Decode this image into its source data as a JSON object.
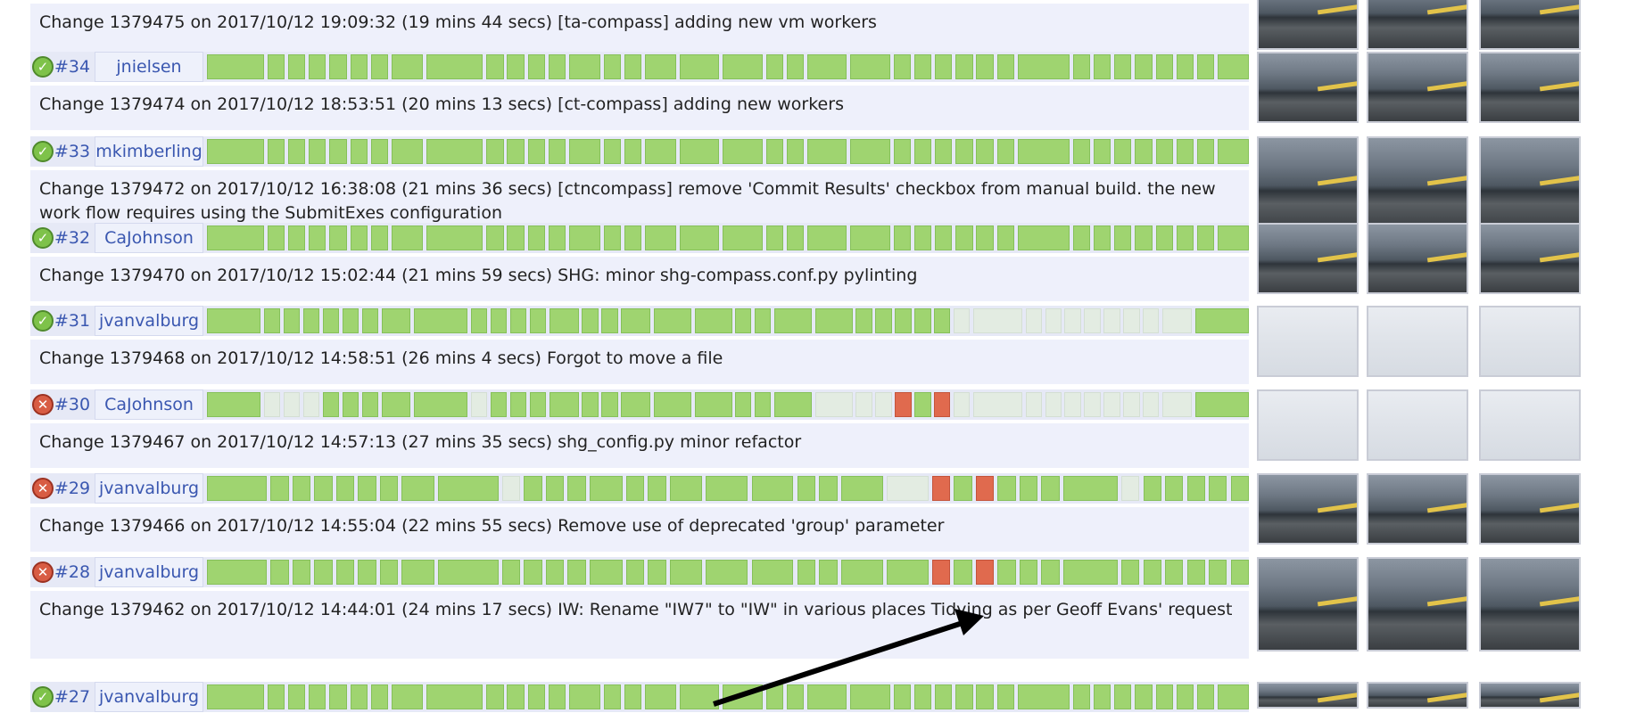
{
  "builds": [
    {
      "num": "",
      "user": "",
      "status": "ok",
      "message": "Change 1379475 on 2017/10/12 19:09:32 (19 mins 44 secs) [ta-compass] adding new vm workers",
      "segments": "gggggggggggggggggggggggggggggggggggggg",
      "thumbs": "dark"
    },
    {
      "num": "#34",
      "user": "jnielsen",
      "status": "ok",
      "message": "Change 1379474 on 2017/10/12 18:53:51 (20 mins 13 secs) [ct-compass] adding new workers",
      "segments": "gggggggggggggggggggggggggggggggggggggg",
      "thumbs": "dark"
    },
    {
      "num": "#33",
      "user": "mkimberling",
      "status": "ok",
      "message": "Change 1379472 on 2017/10/12 16:38:08 (21 mins 36 secs) [ctncompass] remove 'Commit Results' checkbox from manual build. the new work flow requires using the SubmitExes configuration",
      "segments": "gggggggggggggggggggggggggggggggggggggg",
      "thumbs": "dark"
    },
    {
      "num": "#32",
      "user": "CaJohnson",
      "status": "ok",
      "message": "Change 1379470 on 2017/10/12 15:02:44 (21 mins 59 secs) SHG: minor shg-compass.conf.py pylinting",
      "segments": "gggggggggggggggggggggggggggggggggggggg",
      "thumbs": "dark"
    },
    {
      "num": "#31",
      "user": "jvanvalburg",
      "status": "ok",
      "message": "Change 1379468 on 2017/10/12 14:58:51 (26 mins 4 secs) Forgot to move a file",
      "segments": "ggggggggggggggggggggggggggggllllllllllg",
      "thumbs": "pale"
    },
    {
      "num": "#30",
      "user": "CaJohnson",
      "status": "fail",
      "message": "Change 1379467 on 2017/10/12 14:57:13 (27 mins 35 secs) shg_config.py minor refactor",
      "segments": "glllggggglgggggggggggglllrgrllllllllllg",
      "thumbs": "pale"
    },
    {
      "num": "#29",
      "user": "jvanvalburg",
      "status": "fail",
      "message": "Change 1379466 on 2017/10/12 14:55:04 (22 mins 55 secs) Remove use of deprecated 'group' parameter",
      "segments": "ggggggggglgggggggggggglrgrgggglggggg",
      "thumbs": "dark"
    },
    {
      "num": "#28",
      "user": "jvanvalburg",
      "status": "fail",
      "message": "Change 1379462 on 2017/10/12 14:44:01 (24 mins 17 secs) IW: Rename \"IW7\" to \"IW\" in various places Tidying as per Geoff Evans' request",
      "segments": "gggggggggggggggggggggggrgrgggggggggg",
      "thumbs": "dark"
    },
    {
      "num": "#27",
      "user": "jvanvalburg",
      "status": "ok",
      "message": "",
      "segments": "gggggggggggggggggggggggggggggggggggggg",
      "thumbs": "dark"
    }
  ],
  "colors": {
    "pass": "#9fd470",
    "fail": "#e06a4e",
    "pending": "#e3ece2",
    "link": "#3a57b0"
  }
}
